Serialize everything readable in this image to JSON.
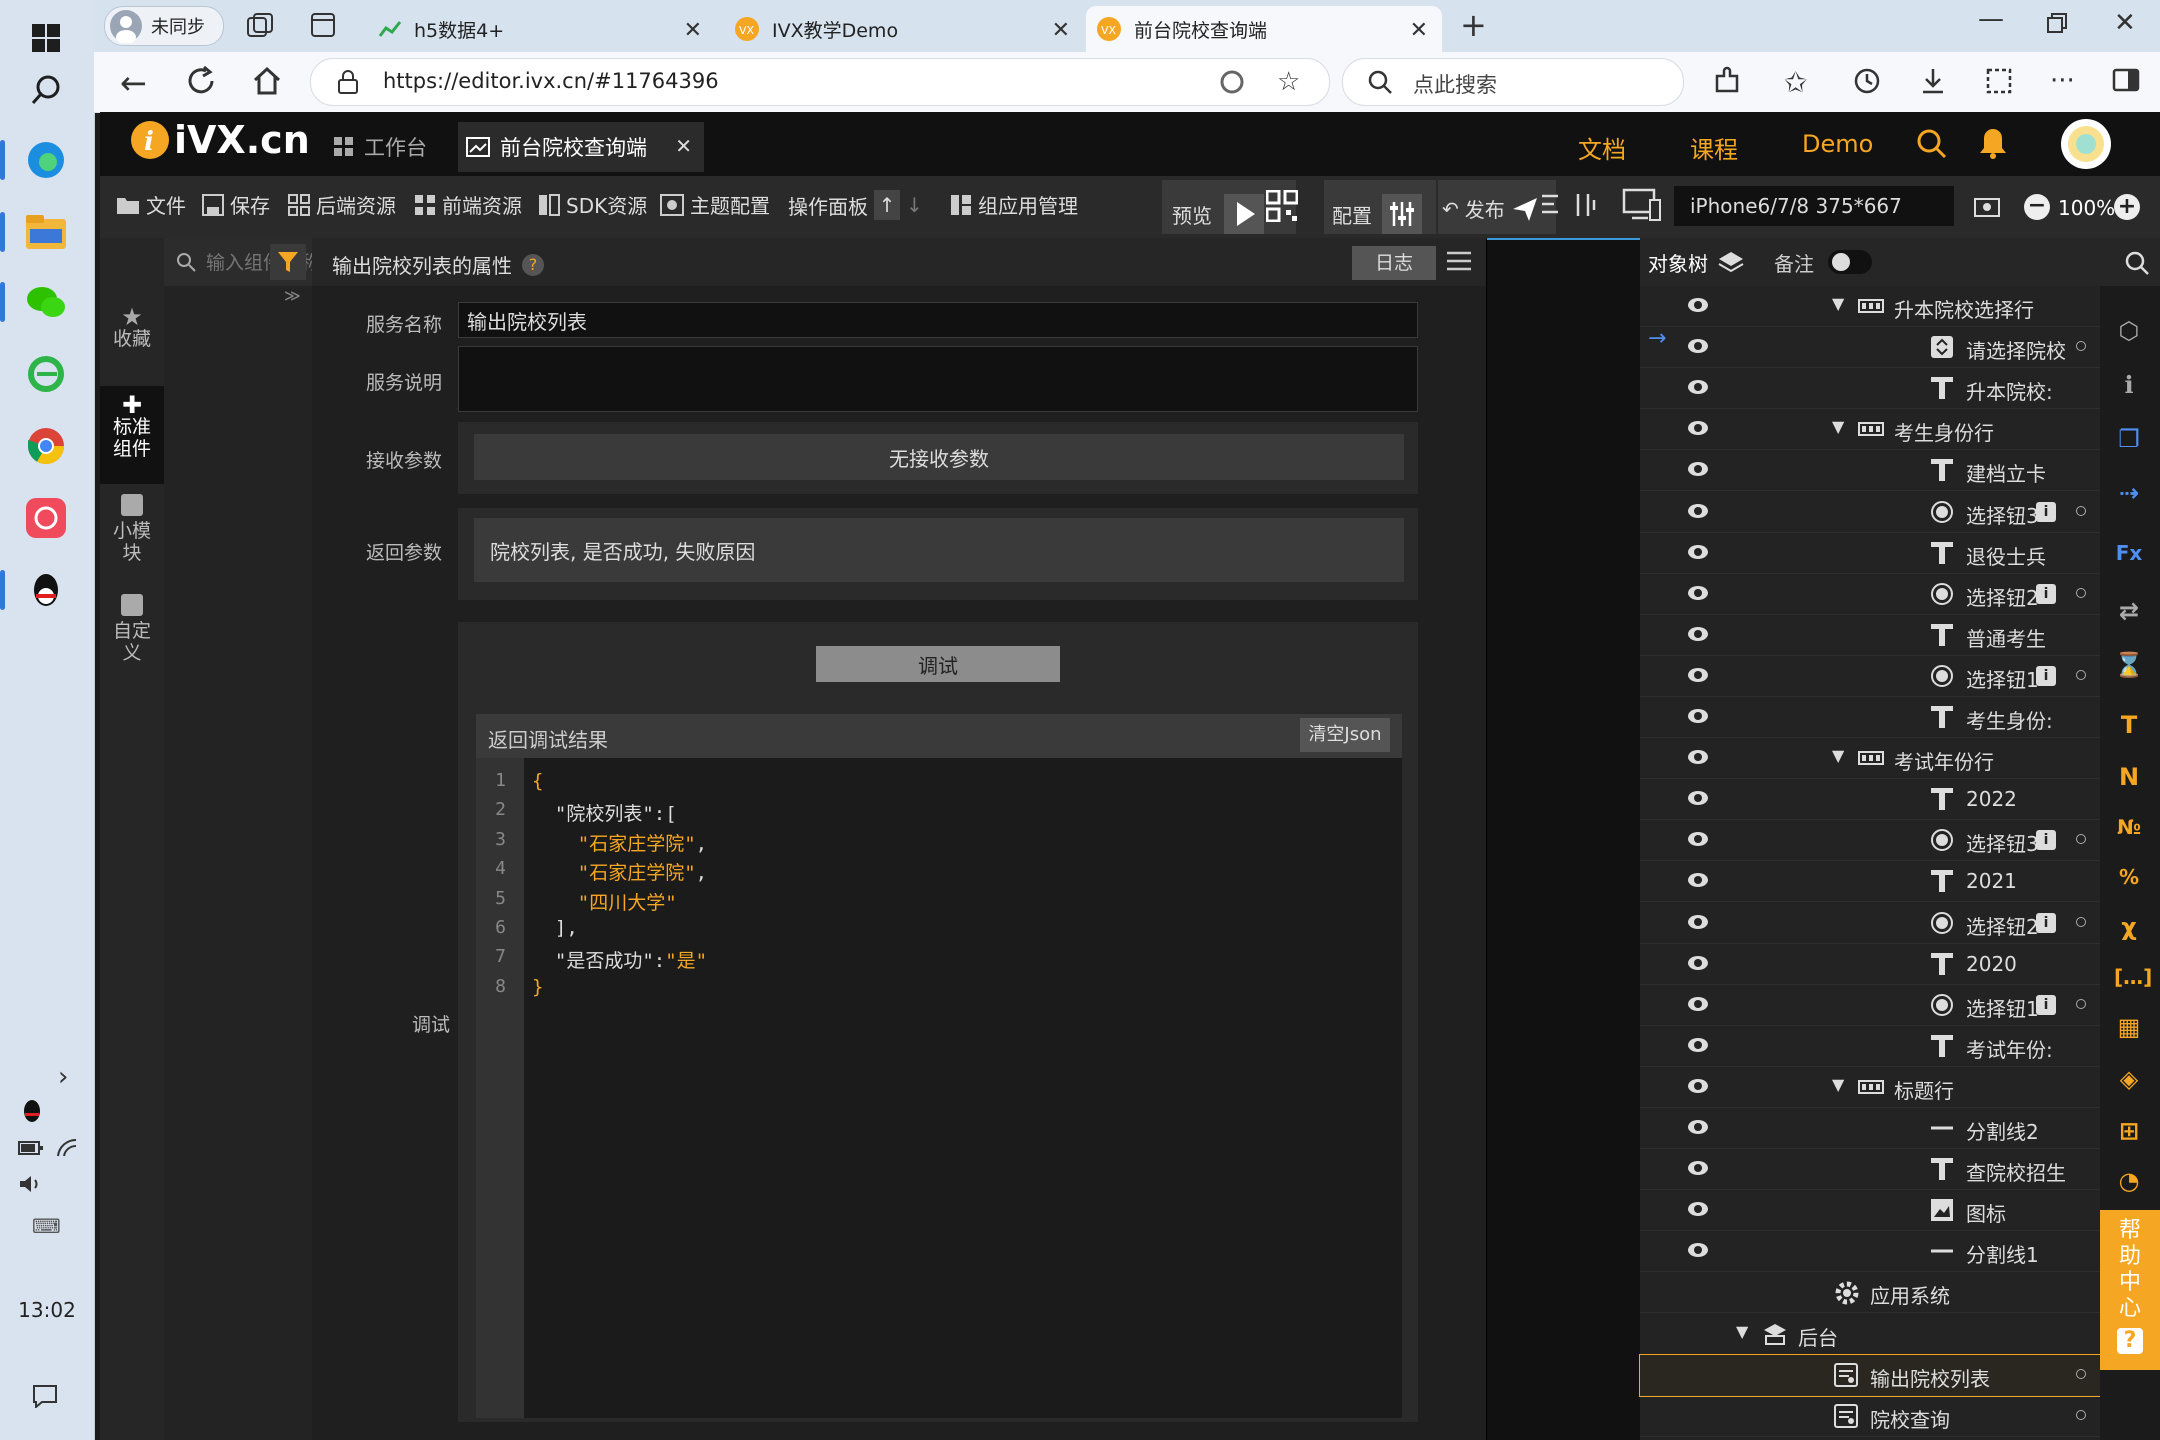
{
  "taskbar": {
    "clock": "13:02"
  },
  "browser": {
    "profile": "未同步",
    "tabs": [
      {
        "title": "h5数据4+"
      },
      {
        "title": "IVX教学Demo"
      },
      {
        "title": "前台院校查询端"
      }
    ],
    "url": "https://editor.ivx.cn/#11764396",
    "search_placeholder": "点此搜索"
  },
  "app": {
    "logo": "iVX.cn",
    "tabs": [
      {
        "label": "工作台"
      },
      {
        "label": "前台院校查询端"
      }
    ],
    "top_menu": [
      "文档",
      "课程",
      "Demo"
    ],
    "toolbar": {
      "file": "文件",
      "save": "保存",
      "backend": "后端资源",
      "frontend": "前端资源",
      "sdk": "SDK资源",
      "theme": "主题配置",
      "panel": "操作面板",
      "group": "组应用管理",
      "preview": "预览",
      "config": "配置",
      "publish": "发布",
      "device": "iPhone6/7/8 375*667",
      "zoom": "100%"
    },
    "left_nav": [
      {
        "label": "收藏"
      },
      {
        "label": "标准组件"
      },
      {
        "label": "小模块"
      },
      {
        "label": "自定义"
      }
    ],
    "component_search_placeholder": "输入组件名称",
    "properties": {
      "title": "输出院校列表的属性",
      "help": "?",
      "log_button": "日志",
      "service_name_label": "服务名称",
      "service_name_value": "输出院校列表",
      "service_desc_label": "服务说明",
      "receive_label": "接收参数",
      "receive_value": "无接收参数",
      "return_label": "返回参数",
      "return_value": "院校列表, 是否成功, 失败原因",
      "debug_label": "调试",
      "debug_button": "调试",
      "result_title": "返回调试结果",
      "clear_json": "清空Json",
      "code_lines": [
        {
          "n": "1",
          "text": "{"
        },
        {
          "n": "2",
          "text": "  \"院校列表\":["
        },
        {
          "n": "3",
          "text": "    \"石家庄学院\","
        },
        {
          "n": "4",
          "text": "    \"石家庄学院\","
        },
        {
          "n": "5",
          "text": "    \"四川大学\""
        },
        {
          "n": "6",
          "text": "  ],"
        },
        {
          "n": "7",
          "text": "  \"是否成功\":\"是\""
        },
        {
          "n": "8",
          "text": "}"
        }
      ]
    },
    "tree": {
      "tab_objects": "对象树",
      "tab_notes": "备注",
      "rows": [
        {
          "label": "升本院校选择行",
          "icon": "row",
          "indent": 2,
          "caret": true
        },
        {
          "label": "请选择院校",
          "icon": "select",
          "indent": 3
        },
        {
          "label": "升本院校:",
          "icon": "text",
          "indent": 3
        },
        {
          "label": "考生身份行",
          "icon": "row",
          "indent": 2,
          "caret": true
        },
        {
          "label": "建档立卡",
          "icon": "text",
          "indent": 3
        },
        {
          "label": "选择钮3",
          "icon": "radio",
          "indent": 3,
          "badge": true
        },
        {
          "label": "退役士兵",
          "icon": "text",
          "indent": 3
        },
        {
          "label": "选择钮2",
          "icon": "radio",
          "indent": 3,
          "badge": true
        },
        {
          "label": "普通考生",
          "icon": "text",
          "indent": 3
        },
        {
          "label": "选择钮1",
          "icon": "radio",
          "indent": 3,
          "badge": true
        },
        {
          "label": "考生身份:",
          "icon": "text",
          "indent": 3
        },
        {
          "label": "考试年份行",
          "icon": "row",
          "indent": 2,
          "caret": true
        },
        {
          "label": "2022",
          "icon": "text",
          "indent": 3
        },
        {
          "label": "选择钮3",
          "icon": "radio",
          "indent": 3,
          "badge": true
        },
        {
          "label": "2021",
          "icon": "text",
          "indent": 3
        },
        {
          "label": "选择钮2",
          "icon": "radio",
          "indent": 3,
          "badge": true
        },
        {
          "label": "2020",
          "icon": "text",
          "indent": 3
        },
        {
          "label": "选择钮1",
          "icon": "radio",
          "indent": 3,
          "badge": true
        },
        {
          "label": "考试年份:",
          "icon": "text",
          "indent": 3
        },
        {
          "label": "标题行",
          "icon": "row",
          "indent": 2,
          "caret": true
        },
        {
          "label": "分割线2",
          "icon": "line",
          "indent": 3
        },
        {
          "label": "查院校招生",
          "icon": "text",
          "indent": 3
        },
        {
          "label": "图标",
          "icon": "image",
          "indent": 3
        },
        {
          "label": "分割线1",
          "icon": "line",
          "indent": 3
        },
        {
          "label": "应用系统",
          "icon": "gear",
          "indent": 1
        },
        {
          "label": "后台",
          "icon": "server",
          "indent": 0,
          "caret": true
        },
        {
          "label": "输出院校列表",
          "icon": "service",
          "indent": 1,
          "selected": true
        },
        {
          "label": "院校查询",
          "icon": "service",
          "indent": 1
        }
      ]
    },
    "help_center": "帮助中心"
  }
}
